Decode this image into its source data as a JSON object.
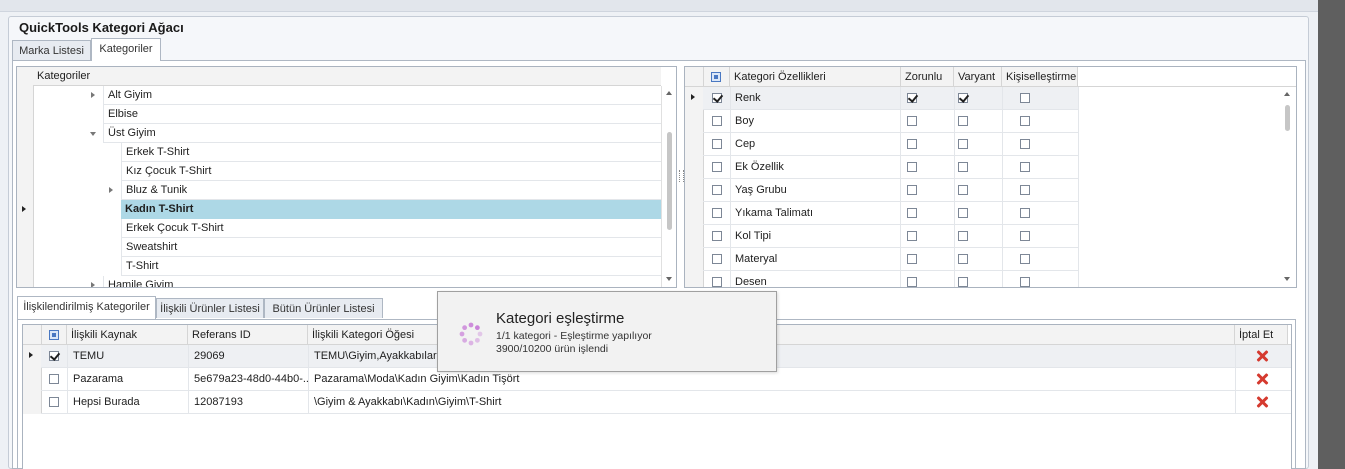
{
  "window": {
    "title": "QuickTools Kategori Ağacı"
  },
  "top_tabs": [
    {
      "label": "Marka Listesi"
    },
    {
      "label": "Kategoriler"
    }
  ],
  "tree": {
    "header": "Kategoriler",
    "rows": [
      {
        "label": "Alt Giyim"
      },
      {
        "label": "Elbise"
      },
      {
        "label": "Üst Giyim"
      },
      {
        "label": "Erkek T-Shirt"
      },
      {
        "label": "Kız Çocuk T-Shirt"
      },
      {
        "label": "Bluz & Tunik"
      },
      {
        "label": "Kadın T-Shirt"
      },
      {
        "label": "Erkek Çocuk T-Shirt"
      },
      {
        "label": "Sweatshirt"
      },
      {
        "label": "T-Shirt"
      },
      {
        "label": "Hamile Giyim"
      }
    ]
  },
  "features": {
    "headers": {
      "name": "Kategori Özellikleri",
      "required": "Zorunlu",
      "variant": "Varyant",
      "custom": "Kişiselleştirme"
    },
    "rows": [
      {
        "name": "Renk",
        "selected": true,
        "required": true,
        "variant": true,
        "custom": false
      },
      {
        "name": "Boy",
        "selected": false,
        "required": false,
        "variant": false,
        "custom": false
      },
      {
        "name": "Cep",
        "selected": false,
        "required": false,
        "variant": false,
        "custom": false
      },
      {
        "name": "Ek Özellik",
        "selected": false,
        "required": false,
        "variant": false,
        "custom": false
      },
      {
        "name": "Yaş Grubu",
        "selected": false,
        "required": false,
        "variant": false,
        "custom": false
      },
      {
        "name": "Yıkama Talimatı",
        "selected": false,
        "required": false,
        "variant": false,
        "custom": false
      },
      {
        "name": "Kol Tipi",
        "selected": false,
        "required": false,
        "variant": false,
        "custom": false
      },
      {
        "name": "Materyal",
        "selected": false,
        "required": false,
        "variant": false,
        "custom": false
      },
      {
        "name": "Desen",
        "selected": false,
        "required": false,
        "variant": false,
        "custom": false
      }
    ]
  },
  "bottom_tabs": [
    {
      "label": "İlişkilendirilmiş Kategoriler"
    },
    {
      "label": "İlişkili Ürünler Listesi"
    },
    {
      "label": "Bütün Ürünler Listesi"
    }
  ],
  "relations": {
    "headers": {
      "source": "İlişkili Kaynak",
      "ref": "Referans ID",
      "path": "İlişkili Kategori Öğesi",
      "cancel": "İptal Et"
    },
    "rows": [
      {
        "source": "TEMU",
        "ref": "29069",
        "path": "TEMU\\Giyim,Ayakkabılar,",
        "selected": true
      },
      {
        "source": "Pazarama",
        "ref": "5e679a23-48d0-44b0-...",
        "path": "Pazarama\\Moda\\Kadın Giyim\\Kadın Tişört",
        "selected": false
      },
      {
        "source": "Hepsi Burada",
        "ref": "12087193",
        "path": "\\Giyim & Ayakkabı\\Kadın\\Giyim\\T-Shirt",
        "selected": false
      }
    ]
  },
  "progress_popup": {
    "title": "Kategori eşleştirme",
    "line1": "1/1 kategori - Eşleştirme yapılıyor",
    "line2": "3900/10200 ürün işlendi",
    "spinner_color": "#c678d6"
  },
  "colors": {
    "selected_row": "#add8e6",
    "accent": "#c678d6"
  }
}
